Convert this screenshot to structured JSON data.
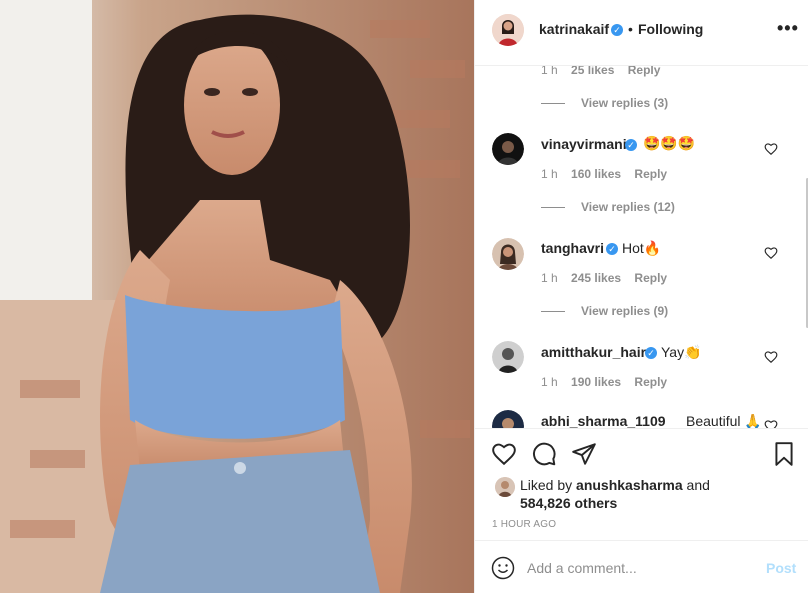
{
  "post": {
    "photo_alt": "Woman in blue crop top and denim shorts"
  },
  "header": {
    "username": "katrinakaif",
    "separator": "•",
    "follow_label": "Following",
    "more_label": "•••"
  },
  "comments": {
    "top_partial": {
      "time": "1 h",
      "likes": "25 likes",
      "reply": "Reply",
      "view_replies": "View replies (3)"
    },
    "items": [
      {
        "username": "vinayvirmani",
        "text": "🤩🤩🤩",
        "time": "1 h",
        "likes": "160 likes",
        "reply": "Reply",
        "view_replies": "View replies (12)"
      },
      {
        "username": "tanghavri",
        "text": "Hot🔥",
        "time": "1 h",
        "likes": "245 likes",
        "reply": "Reply",
        "view_replies": "View replies (9)"
      },
      {
        "username": "amitthakur_hair",
        "text": "Yay👏",
        "time": "1 h",
        "likes": "190 likes",
        "reply": "Reply"
      },
      {
        "username": "abhi_sharma_1109",
        "text": "Beautiful 🙏"
      }
    ]
  },
  "likes": {
    "prefix": "Liked by ",
    "user": "anushkasharma",
    "and": " and",
    "others": "584,826 others"
  },
  "timestamp": "1 HOUR AGO",
  "comment_box": {
    "placeholder": "Add a comment...",
    "post_label": "Post"
  },
  "colors": {
    "verified": "#3897f0",
    "post_disabled": "#b2dffc",
    "muted": "#8e8e8e"
  }
}
